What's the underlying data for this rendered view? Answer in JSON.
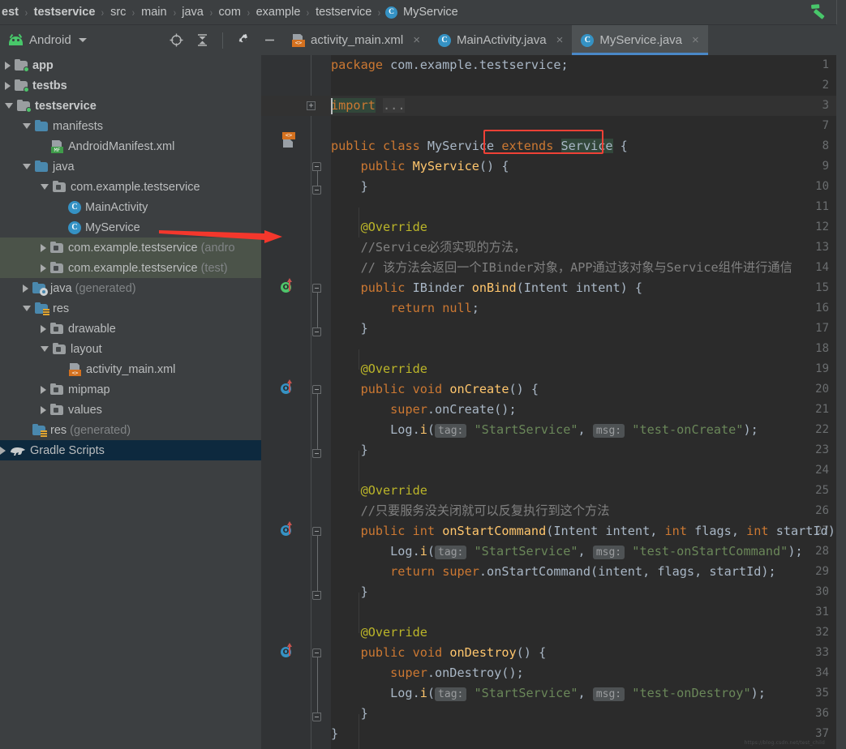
{
  "breadcrumb": {
    "items": [
      {
        "label": "est",
        "style": "bold"
      },
      {
        "label": "testservice",
        "style": "bold"
      },
      {
        "label": "src",
        "style": "normal"
      },
      {
        "label": "main",
        "style": "normal"
      },
      {
        "label": "java",
        "style": "normal"
      },
      {
        "label": "com",
        "style": "normal"
      },
      {
        "label": "example",
        "style": "normal"
      },
      {
        "label": "testservice",
        "style": "normal"
      }
    ],
    "class_item": {
      "label": "MyService",
      "icon": "C"
    },
    "separator": "›",
    "build_icon": "hammer-icon"
  },
  "toolbar": {
    "project_view_label": "Android",
    "icons": [
      "locate-icon",
      "collapse-all-icon",
      "settings-gear-icon",
      "hide-icon"
    ]
  },
  "tabs": [
    {
      "label": "activity_main.xml",
      "icon": "xml-layout-icon",
      "active": false,
      "close": "×"
    },
    {
      "label": "MainActivity.java",
      "icon": "java-class-icon",
      "active": false,
      "close": "×"
    },
    {
      "label": "MyService.java",
      "icon": "java-class-icon",
      "active": true,
      "close": "×"
    }
  ],
  "tree": [
    {
      "label": "app",
      "indent": 0,
      "arrow": "right",
      "icon": "module-folder",
      "bold": true,
      "sel": "none"
    },
    {
      "label": "testbs",
      "indent": 0,
      "arrow": "right",
      "icon": "module-folder",
      "bold": true,
      "sel": "none"
    },
    {
      "label": "testservice",
      "indent": 0,
      "arrow": "down",
      "icon": "module-folder",
      "bold": true,
      "sel": "none"
    },
    {
      "label": "manifests",
      "indent": 1,
      "arrow": "down",
      "icon": "folder-blue",
      "bold": false,
      "sel": "none"
    },
    {
      "label": "AndroidManifest.xml",
      "indent": 2,
      "arrow": "none",
      "icon": "manifest-file",
      "bold": false,
      "sel": "none"
    },
    {
      "label": "java",
      "indent": 1,
      "arrow": "down",
      "icon": "folder-blue",
      "bold": false,
      "sel": "none"
    },
    {
      "label": "com.example.testservice",
      "indent": 2,
      "arrow": "down",
      "icon": "package-folder",
      "bold": false,
      "sel": "none"
    },
    {
      "label": "MainActivity",
      "indent": 3,
      "arrow": "none",
      "icon": "java-class",
      "bold": false,
      "sel": "none"
    },
    {
      "label": "MyService",
      "indent": 3,
      "arrow": "none",
      "icon": "java-class",
      "bold": false,
      "sel": "none"
    },
    {
      "label": "com.example.testservice ",
      "dim": "(andro",
      "indent": 2,
      "arrow": "right",
      "icon": "package-folder",
      "bold": false,
      "sel": "green"
    },
    {
      "label": "com.example.testservice ",
      "dim": "(test)",
      "indent": 2,
      "arrow": "right",
      "icon": "package-folder",
      "bold": false,
      "sel": "green"
    },
    {
      "label": "java ",
      "dim": "(generated)",
      "indent": 1,
      "arrow": "right",
      "icon": "folder-generated",
      "bold": false,
      "sel": "none"
    },
    {
      "label": "res",
      "indent": 1,
      "arrow": "down",
      "icon": "folder-res",
      "bold": false,
      "sel": "none"
    },
    {
      "label": "drawable",
      "indent": 2,
      "arrow": "right",
      "icon": "package-folder",
      "bold": false,
      "sel": "none"
    },
    {
      "label": "layout",
      "indent": 2,
      "arrow": "down",
      "icon": "package-folder",
      "bold": false,
      "sel": "none"
    },
    {
      "label": "activity_main.xml",
      "indent": 3,
      "arrow": "none",
      "icon": "xml-file",
      "bold": false,
      "sel": "none"
    },
    {
      "label": "mipmap",
      "indent": 2,
      "arrow": "right",
      "icon": "package-folder",
      "bold": false,
      "sel": "none"
    },
    {
      "label": "values",
      "indent": 2,
      "arrow": "right",
      "icon": "package-folder",
      "bold": false,
      "sel": "none"
    },
    {
      "label": "res ",
      "dim": "(generated)",
      "indent": 1,
      "arrow": "none",
      "icon": "folder-res",
      "bold": false,
      "sel": "none"
    },
    {
      "label": "Gradle Scripts",
      "indent": -1,
      "arrow": "right",
      "icon": "gradle-elephant",
      "bold": false,
      "sel": "blue"
    }
  ],
  "editor": {
    "file": "MyService.java",
    "line_numbers": [
      1,
      2,
      3,
      7,
      8,
      9,
      10,
      11,
      12,
      13,
      14,
      15,
      16,
      17,
      18,
      19,
      20,
      21,
      22,
      23,
      24,
      25,
      26,
      27,
      28,
      29,
      30,
      31,
      32,
      33,
      34,
      35,
      36,
      37
    ],
    "code": [
      {
        "n": 1,
        "html": "<span class='kw'>package</span> com.example.testservice;"
      },
      {
        "n": 2,
        "html": ""
      },
      {
        "n": 3,
        "html": "<span class='kw hl-green'>import</span> <span class='cmt' style='background:#3a3a3a'>...</span>"
      },
      {
        "n": 7,
        "html": ""
      },
      {
        "n": 8,
        "html": "<span class='kw'>public</span> <span class='kw'>class</span> MyService <span class='kw'>extends</span> <span class='hl-green'>Service</span> {"
      },
      {
        "n": 9,
        "html": "    <span class='kw'>public</span> <span class='mth'>MyService</span>() {"
      },
      {
        "n": 10,
        "html": "    }"
      },
      {
        "n": 11,
        "html": ""
      },
      {
        "n": 12,
        "html": "    <span class='ann'>@Override</span>"
      },
      {
        "n": 13,
        "html": "    <span class='cmt'>//Service必须实现的方法，</span>"
      },
      {
        "n": 14,
        "html": "    <span class='cmt'>// 该方法会返回一个IBinder对象，APP通过该对象与Service组件进行通信</span>"
      },
      {
        "n": 15,
        "html": "    <span class='kw'>public</span> IBinder <span class='mth'>onBind</span>(Intent intent) {"
      },
      {
        "n": 16,
        "html": "        <span class='kw'>return</span> <span class='kw'>null</span>;"
      },
      {
        "n": 17,
        "html": "    }"
      },
      {
        "n": 18,
        "html": ""
      },
      {
        "n": 19,
        "html": "    <span class='ann'>@Override</span>"
      },
      {
        "n": 20,
        "html": "    <span class='kw'>public</span> <span class='kw'>void</span> <span class='mth'>onCreate</span>() {"
      },
      {
        "n": 21,
        "html": "        <span class='kw'>super</span>.onCreate();"
      },
      {
        "n": 22,
        "html": "        Log.<span class='mth'>i</span>(<span class='hint'>tag:</span> <span class='str'>\"StartService\"</span>, <span class='hint'>msg:</span> <span class='str'>\"test-onCreate\"</span>);"
      },
      {
        "n": 23,
        "html": "    }"
      },
      {
        "n": 24,
        "html": ""
      },
      {
        "n": 25,
        "html": "    <span class='ann'>@Override</span>"
      },
      {
        "n": 26,
        "html": "    <span class='cmt'>//只要服务没关闭就可以反复执行到这个方法</span>"
      },
      {
        "n": 27,
        "html": "    <span class='kw'>public</span> <span class='kw'>int</span> <span class='mth'>onStartCommand</span>(Intent intent, <span class='kw'>int</span> flags, <span class='kw'>int</span> startId) {"
      },
      {
        "n": 28,
        "html": "        Log.<span class='mth'>i</span>(<span class='hint'>tag:</span> <span class='str'>\"StartService\"</span>, <span class='hint'>msg:</span> <span class='str'>\"test-onStartCommand\"</span>);"
      },
      {
        "n": 29,
        "html": "        <span class='kw'>return</span> <span class='kw'>super</span>.onStartCommand(intent, flags, startId);"
      },
      {
        "n": 30,
        "html": "    }"
      },
      {
        "n": 31,
        "html": ""
      },
      {
        "n": 32,
        "html": "    <span class='ann'>@Override</span>"
      },
      {
        "n": 33,
        "html": "    <span class='kw'>public</span> <span class='kw'>void</span> <span class='mth'>onDestroy</span>() {"
      },
      {
        "n": 34,
        "html": "        <span class='kw'>super</span>.onDestroy();"
      },
      {
        "n": 35,
        "html": "        Log.<span class='mth'>i</span>(<span class='hint'>tag:</span> <span class='str'>\"StartService\"</span>, <span class='hint'>msg:</span> <span class='str'>\"test-onDestroy\"</span>);"
      },
      {
        "n": 36,
        "html": "    }"
      },
      {
        "n": 37,
        "html": "}"
      }
    ],
    "gutter_markers": [
      {
        "line": 8,
        "type": "xml-layout-icon"
      },
      {
        "line": 15,
        "type": "override-green"
      },
      {
        "line": 20,
        "type": "override-blue"
      },
      {
        "line": 27,
        "type": "override-blue"
      },
      {
        "line": 33,
        "type": "override-blue"
      }
    ],
    "watermark": "https://blog.csdn.net/test_child"
  },
  "annotations": {
    "red_box_target": "extends Service",
    "red_arrow_from": "MyService",
    "red_arrow_to_line": 12,
    "accent_red": "#ef4136",
    "accent_blue": "#4a88c7",
    "accent_green": "#48c76a"
  }
}
